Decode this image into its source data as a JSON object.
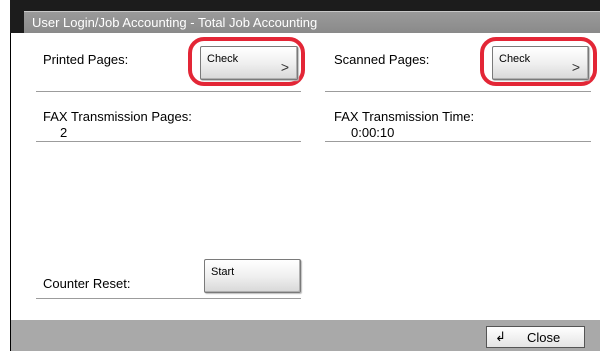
{
  "window": {
    "title": "User Login/Job Accounting - Total Job Accounting"
  },
  "printed_pages": {
    "label": "Printed Pages:",
    "button_label": "Check",
    "button_chevron": ">"
  },
  "scanned_pages": {
    "label": "Scanned Pages:",
    "button_label": "Check",
    "button_chevron": ">"
  },
  "fax_transmission_pages": {
    "label": "FAX Transmission Pages:",
    "value": "2"
  },
  "fax_transmission_time": {
    "label": "FAX Transmission Time:",
    "value": "0:00:10"
  },
  "counter_reset": {
    "label": "Counter Reset:",
    "button_label": "Start"
  },
  "footer": {
    "close_icon": "↲",
    "close_label": "Close"
  },
  "colors": {
    "highlight": "#e32636",
    "title_bar": "#8f8f8f",
    "bottom_bar": "#a9a9a9"
  }
}
